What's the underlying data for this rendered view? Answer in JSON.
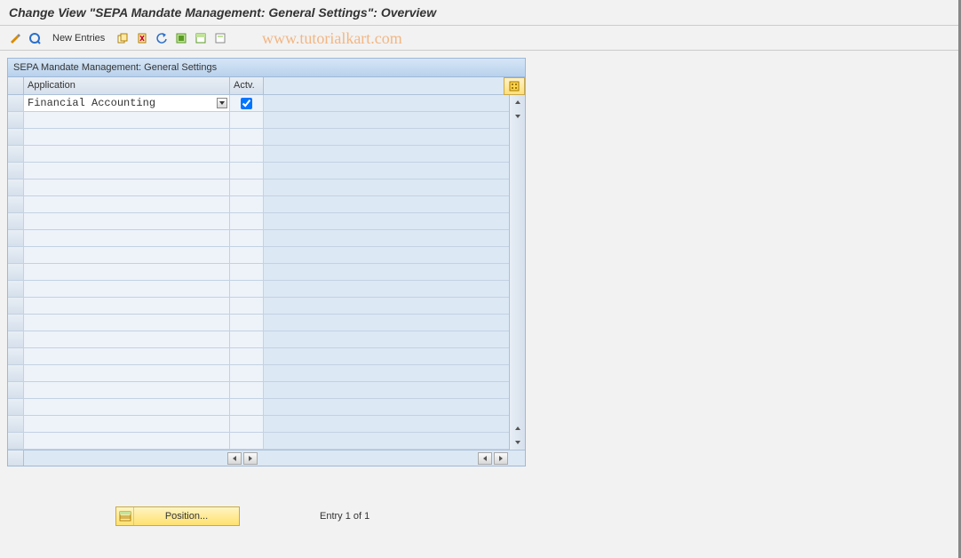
{
  "title": "Change View \"SEPA Mandate Management: General Settings\": Overview",
  "toolbar": {
    "new_entries": "New Entries"
  },
  "watermark": "www.tutorialkart.com",
  "panel": {
    "title": "SEPA Mandate Management: General Settings"
  },
  "columns": {
    "application": "Application",
    "actv": "Actv."
  },
  "rows": [
    {
      "application": "Financial Accounting",
      "actv": true
    }
  ],
  "footer": {
    "position_button": "Position...",
    "entry_text": "Entry 1 of 1"
  },
  "colors": {
    "accent": "#b9d1ec",
    "warn": "#ffe16f"
  }
}
